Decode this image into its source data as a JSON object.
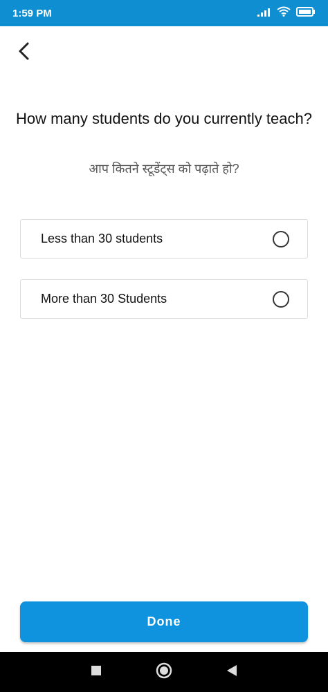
{
  "status_bar": {
    "time": "1:59 PM",
    "icons": [
      "signal-icon",
      "wifi-icon",
      "battery-icon"
    ]
  },
  "header": {
    "back_icon": "chevron-left-icon"
  },
  "question": {
    "title": "How many students do you currently teach?",
    "subtitle": "आप कितने स्टूडेंट्स को पढ़ाते हो?"
  },
  "options": [
    {
      "label": "Less than 30 students",
      "selected": false
    },
    {
      "label": "More than 30 Students",
      "selected": false
    }
  ],
  "done_button": {
    "label": "Done"
  },
  "colors": {
    "accent": "#0f93df",
    "status_bar": "#0f8fd2"
  },
  "nav_bar": {
    "icons": [
      "recent-apps-icon",
      "home-icon",
      "back-triangle-icon"
    ]
  }
}
